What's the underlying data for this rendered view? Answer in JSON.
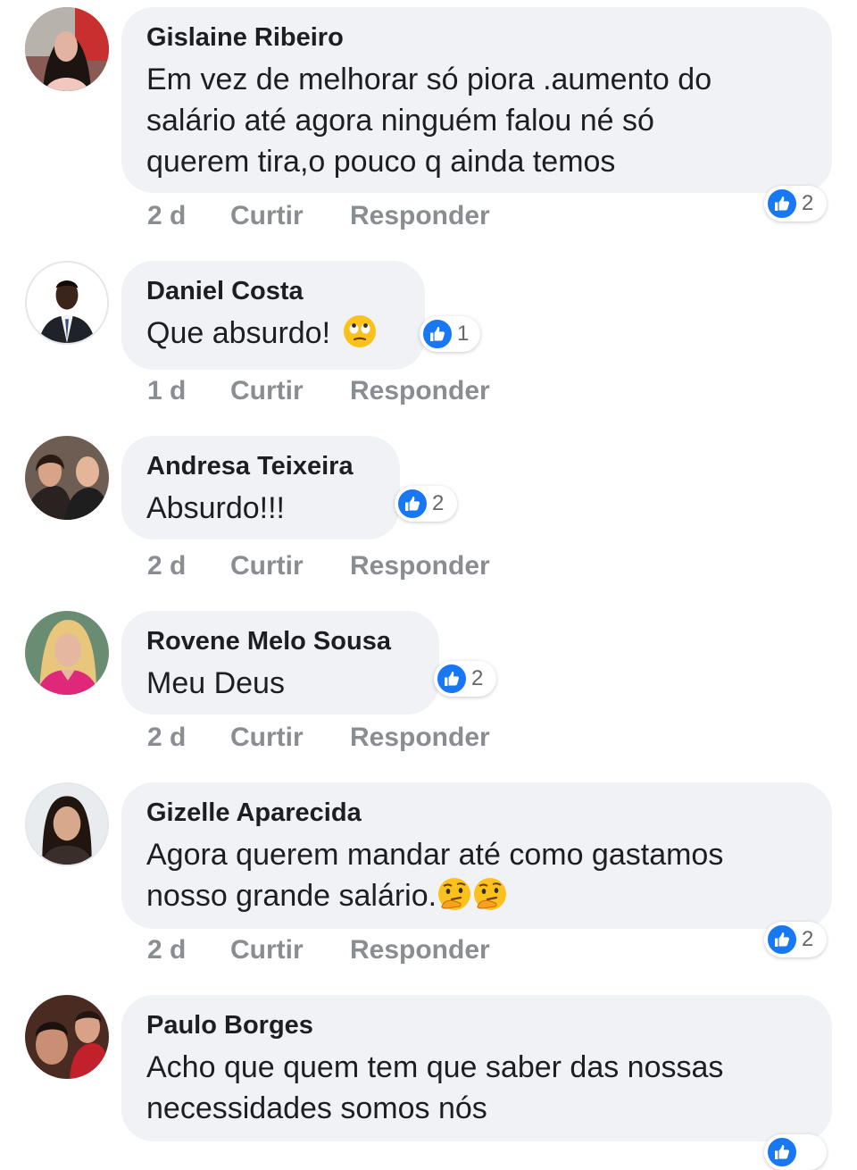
{
  "colors": {
    "bubble": "#f0f2f5",
    "like_blue": "#1877f2",
    "meta_text": "#8a8d91",
    "name_text": "#1c1e21"
  },
  "comments": [
    {
      "author": "Gislaine Ribeiro",
      "lines": [
        "Em vez de melhorar só piora  .aumento do",
        "salário  até  agora ninguém falou né só",
        "querem tira,o pouco q ainda temos"
      ],
      "time": "2 d",
      "like_label": "Curtir",
      "reply_label": "Responder",
      "reaction_icon": "like-icon",
      "reaction_count": "2"
    },
    {
      "author": "Daniel Costa",
      "lines": [
        "Que absurdo!"
      ],
      "emoji": [
        "face-with-rolling-eyes"
      ],
      "time": "1 d",
      "like_label": "Curtir",
      "reply_label": "Responder",
      "reaction_icon": "like-icon",
      "reaction_count": "1"
    },
    {
      "author": "Andresa Teixeira",
      "lines": [
        "Absurdo!!!"
      ],
      "time": "2 d",
      "like_label": "Curtir",
      "reply_label": "Responder",
      "reaction_icon": "like-icon",
      "reaction_count": "2"
    },
    {
      "author": "Rovene Melo Sousa",
      "lines": [
        "Meu Deus"
      ],
      "time": "2 d",
      "like_label": "Curtir",
      "reply_label": "Responder",
      "reaction_icon": "like-icon",
      "reaction_count": "2"
    },
    {
      "author": "Gizelle Aparecida",
      "lines": [
        "Agora querem mandar até como gastamos",
        "nosso grande salário."
      ],
      "emoji": [
        "thinking-face",
        "thinking-face"
      ],
      "time": "2 d",
      "like_label": "Curtir",
      "reply_label": "Responder",
      "reaction_icon": "like-icon",
      "reaction_count": "2"
    },
    {
      "author": "Paulo Borges",
      "lines": [
        "Acho que quem tem que saber das nossas",
        "necessidades somos nós"
      ],
      "reaction_icon": "like-icon"
    }
  ]
}
